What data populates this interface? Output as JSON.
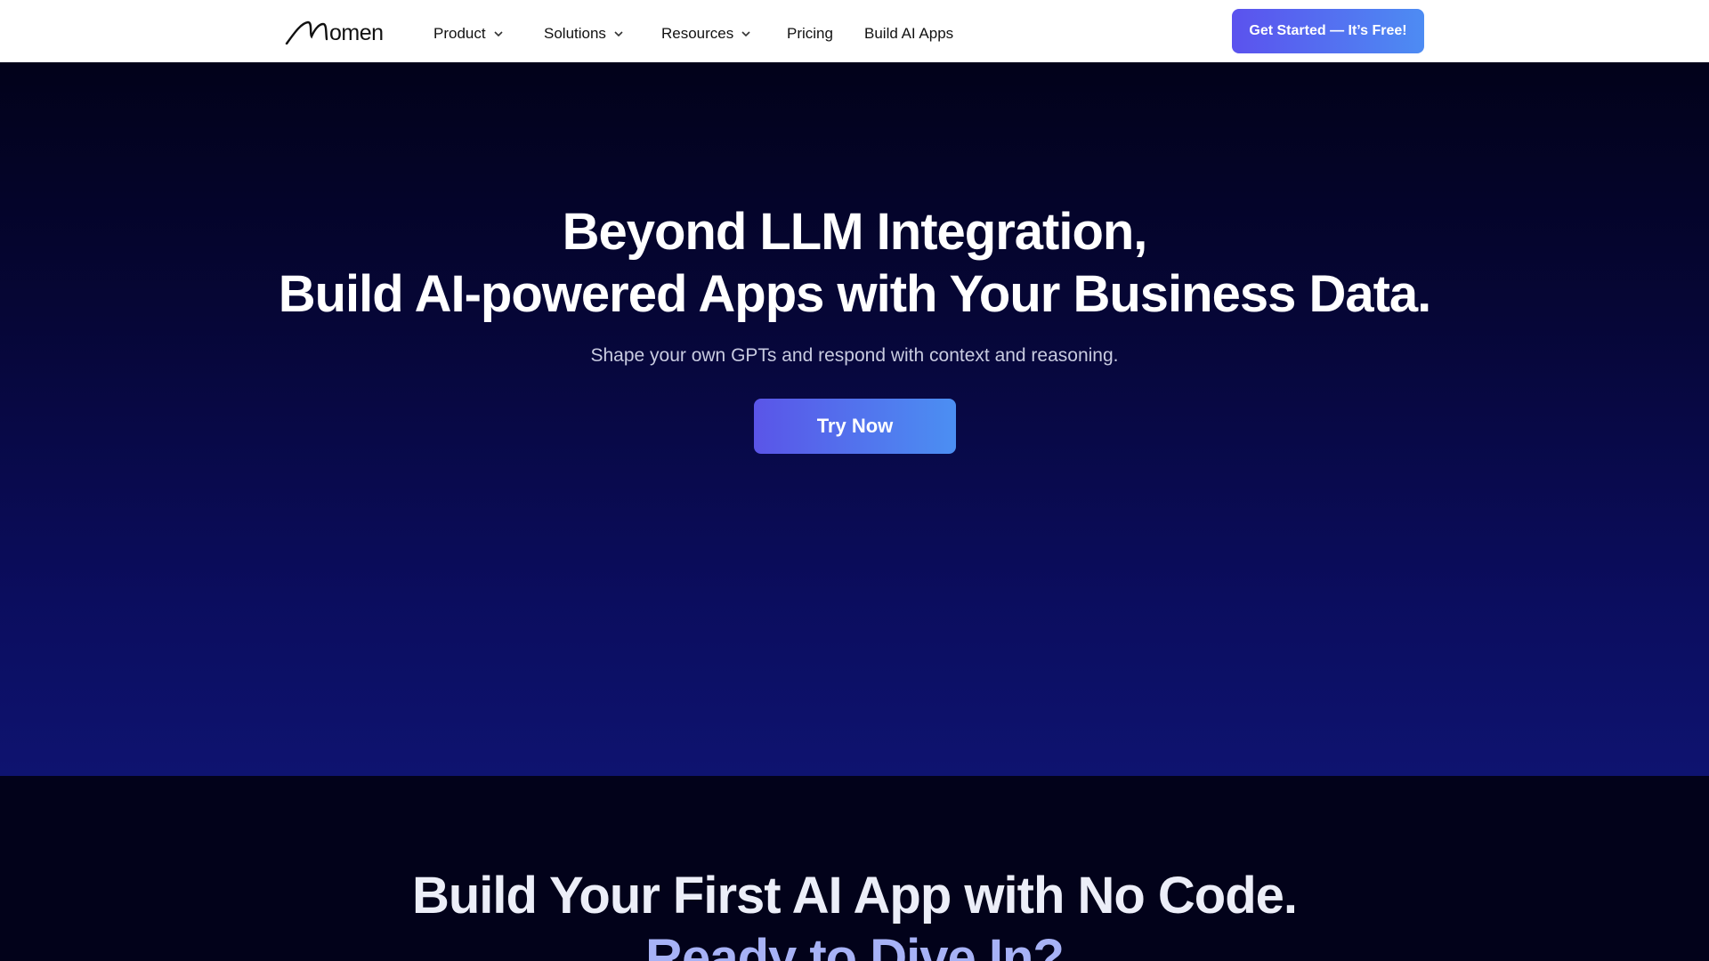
{
  "nav": {
    "logo_text": "omen",
    "logo_icon": "m-script-logo-icon",
    "items": [
      {
        "label": "Product",
        "has_dropdown": true
      },
      {
        "label": "Solutions",
        "has_dropdown": true
      },
      {
        "label": "Resources",
        "has_dropdown": true
      },
      {
        "label": "Pricing",
        "has_dropdown": false
      },
      {
        "label": "Build AI Apps",
        "has_dropdown": false
      }
    ],
    "cta_label": "Get Started — It’s Free!"
  },
  "hero": {
    "title_line1": "Beyond LLM Integration,",
    "title_line2": "Build AI-powered Apps with Your Business Data.",
    "subtitle": "Shape your own GPTs and respond with context and reasoning.",
    "button_label": "Try Now"
  },
  "section2": {
    "title_line1": "Build Your First AI App with No Code.",
    "title_line2": "Ready to Dive In?"
  },
  "colors": {
    "accent_start": "#5b52ee",
    "accent_end": "#4d8cf3",
    "hero_bg_top": "#02021a",
    "hero_bg_bottom": "#0e1370",
    "heading_highlight": "#a7b2f6"
  }
}
